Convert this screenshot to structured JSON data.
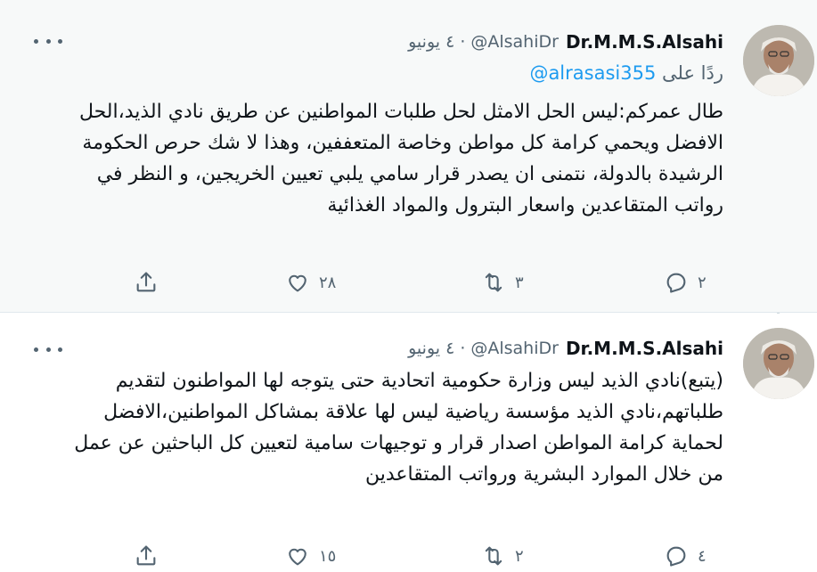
{
  "tweets": [
    {
      "author_name": "Dr.M.M.S.Alsahi",
      "handle": "@AlsahiDr",
      "separator": "·",
      "date": "٤ يونيو",
      "reply_label": "ردًا على",
      "reply_to": "@alrasasi355",
      "text": "طال عمركم:ليس الحل الامثل لحل طلبات المواطنين عن طريق نادي الذيد،الحل الافضل ويحمي كرامة كل مواطن وخاصة المتعففين، وهذا لا شك حرص الحكومة الرشيدة بالدولة، نتمنى ان يصدر قرار سامي يلبي تعيين الخريجين، و النظر في رواتب المتقاعدين واسعار البترول والمواد الغذائية",
      "replies": "٢",
      "retweets": "٣",
      "likes": "٢٨"
    },
    {
      "author_name": "Dr.M.M.S.Alsahi",
      "handle": "@AlsahiDr",
      "separator": "·",
      "date": "٤ يونيو",
      "text": "(يتبع)نادي الذيد ليس وزارة حكومية اتحادية حتى يتوجه لها المواطنون لتقديم طلباتهم،نادي الذيد مؤسسة رياضية ليس لها علاقة بمشاكل المواطنين،الافضل لحماية كرامة المواطن اصدار قرار و توجيهات سامية لتعيين كل الباحثين عن عمل من خلال الموارد البشرية ورواتب المتقاعدين",
      "replies": "٤",
      "retweets": "٢",
      "likes": "١٥"
    }
  ],
  "icons": {
    "more": "more-horizontal-icon",
    "reply": "reply-icon",
    "retweet": "retweet-icon",
    "like": "heart-icon",
    "share": "share-icon"
  },
  "colors": {
    "link": "#1d9bf0",
    "secondary": "#536471",
    "highlight_bg": "#f7f9f9"
  }
}
